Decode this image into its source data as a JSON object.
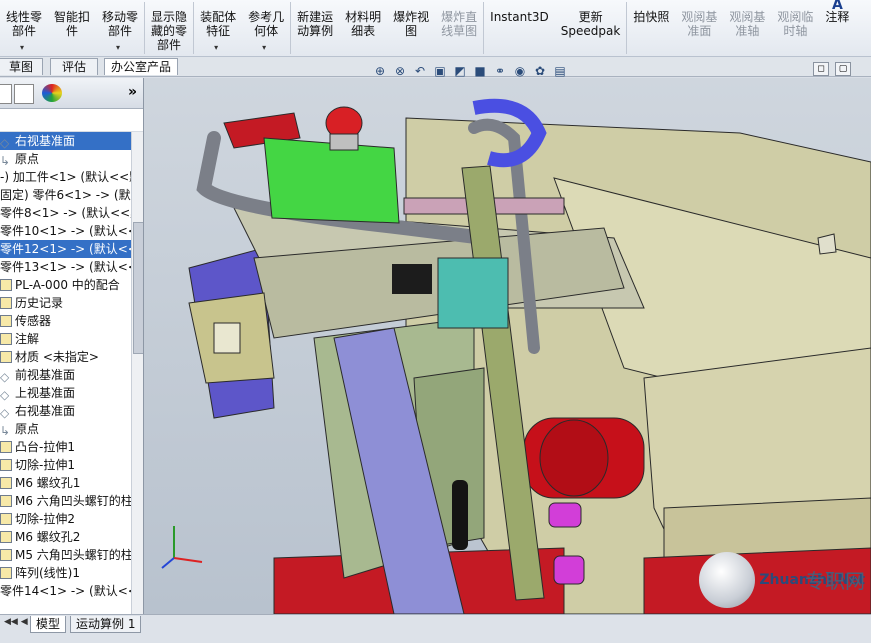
{
  "toolbar": {
    "buttons": [
      {
        "label": "线性零\n部件",
        "caret": true,
        "enabled": true
      },
      {
        "label": "智能扣\n件",
        "caret": false,
        "enabled": true
      },
      {
        "label": "移动零\n部件",
        "caret": true,
        "enabled": true
      },
      {
        "label": "显示隐\n藏的零\n部件",
        "caret": false,
        "enabled": true
      },
      {
        "label": "装配体\n特征",
        "caret": true,
        "enabled": true
      },
      {
        "label": "参考几\n何体",
        "caret": true,
        "enabled": true
      },
      {
        "label": "新建运\n动算例",
        "caret": false,
        "enabled": true
      },
      {
        "label": "材料明\n细表",
        "caret": false,
        "enabled": true
      },
      {
        "label": "爆炸视\n图",
        "caret": false,
        "enabled": true
      },
      {
        "label": "爆炸直\n线草图",
        "caret": false,
        "enabled": false
      },
      {
        "label": "Instant3D",
        "caret": false,
        "enabled": true
      },
      {
        "label": "更新\nSpeedpak",
        "caret": false,
        "enabled": true
      },
      {
        "label": "拍快照",
        "caret": false,
        "enabled": true
      },
      {
        "label": "观阅基\n准面",
        "caret": false,
        "enabled": false
      },
      {
        "label": "观阅基\n准轴",
        "caret": false,
        "enabled": false
      },
      {
        "label": "观阅临\n时轴",
        "caret": false,
        "enabled": false
      },
      {
        "label": "注释",
        "caret": false,
        "enabled": true
      }
    ]
  },
  "command_tabs": [
    "草图",
    "评估",
    "办公室产品"
  ],
  "tree": {
    "more_glyph": "»",
    "items": [
      {
        "label": "右视基准面",
        "icon": "plane",
        "state": "selected"
      },
      {
        "label": "原点",
        "icon": "origin",
        "state": ""
      },
      {
        "label": "-) 加工件<1> (默认<<默",
        "icon": "part",
        "state": ""
      },
      {
        "label": "固定) 零件6<1> -> (默",
        "icon": "part",
        "state": ""
      },
      {
        "label": "零件8<1> -> (默认<<默",
        "icon": "part",
        "state": ""
      },
      {
        "label": "零件10<1> -> (默认<<",
        "icon": "part",
        "state": ""
      },
      {
        "label": "零件12<1> -> (默认<<",
        "icon": "part",
        "state": "selected"
      },
      {
        "label": "零件13<1> -> (默认<<",
        "icon": "part",
        "state": ""
      },
      {
        "label": "PL-A-000 中的配合",
        "icon": "mate",
        "state": ""
      },
      {
        "label": "历史记录",
        "icon": "folder",
        "state": ""
      },
      {
        "label": "传感器",
        "icon": "sensor",
        "state": ""
      },
      {
        "label": "注解",
        "icon": "annotation",
        "state": ""
      },
      {
        "label": "材质 <未指定>",
        "icon": "material",
        "state": ""
      },
      {
        "label": "前视基准面",
        "icon": "plane",
        "state": ""
      },
      {
        "label": "上视基准面",
        "icon": "plane",
        "state": ""
      },
      {
        "label": "右视基准面",
        "icon": "plane",
        "state": ""
      },
      {
        "label": "原点",
        "icon": "origin",
        "state": ""
      },
      {
        "label": "凸台-拉伸1",
        "icon": "feature",
        "state": ""
      },
      {
        "label": "切除-拉伸1",
        "icon": "feature",
        "state": ""
      },
      {
        "label": "M6 螺纹孔1",
        "icon": "hole",
        "state": ""
      },
      {
        "label": "M6 六角凹头螺钉的柱",
        "icon": "hole",
        "state": ""
      },
      {
        "label": "切除-拉伸2",
        "icon": "feature",
        "state": ""
      },
      {
        "label": "M6 螺纹孔2",
        "icon": "hole",
        "state": ""
      },
      {
        "label": "M5 六角凹头螺钉的柱",
        "icon": "hole",
        "state": ""
      },
      {
        "label": "阵列(线性)1",
        "icon": "pattern",
        "state": ""
      },
      {
        "label": "零件14<1> -> (默认<<",
        "icon": "part",
        "state": ""
      }
    ]
  },
  "bottom_tabs": [
    "模型",
    "运动算例 1"
  ],
  "watermark": {
    "cn": "专职网",
    "en": "Zhuanzhi.Net"
  },
  "colors": {
    "accent": "#3470c6",
    "background": "#c8d0da"
  }
}
